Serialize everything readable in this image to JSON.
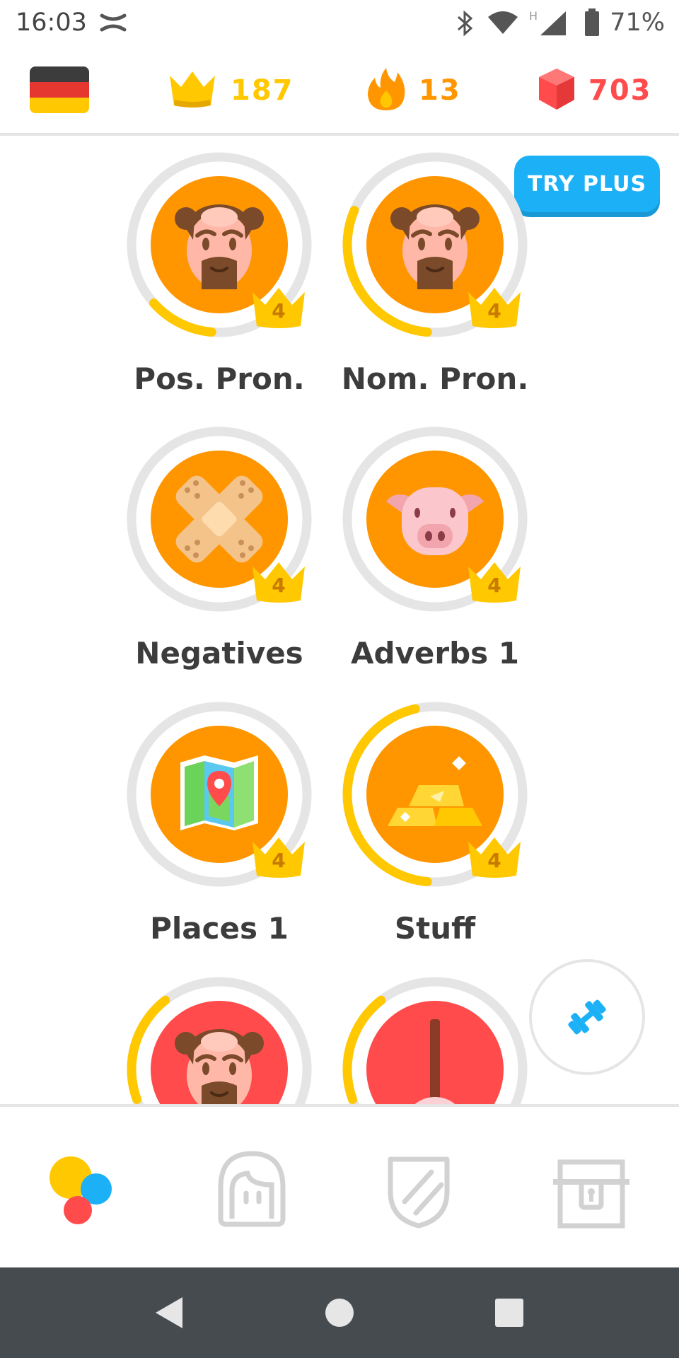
{
  "status_bar": {
    "time": "16:03",
    "battery": "71%",
    "icons": [
      "under-armour-icon",
      "bluetooth-icon",
      "wifi-icon",
      "signal-icon",
      "battery-icon"
    ]
  },
  "top_bar": {
    "flag": "german-flag",
    "crowns": {
      "value": "187",
      "icon": "crown-icon",
      "color": "#ffc800"
    },
    "streak": {
      "value": "13",
      "icon": "flame-icon",
      "color": "#ff9600"
    },
    "gems": {
      "value": "703",
      "icon": "gem-icon",
      "color": "#ff4b4b"
    }
  },
  "try_plus": {
    "label": "TRY PLUS",
    "color": "#1cb0f6"
  },
  "skills": [
    {
      "label": "Pos. Pron.",
      "icon": "man-icon",
      "crown_level": "4",
      "progress": 0.12,
      "color": "#ff9600"
    },
    {
      "label": "Nom. Pron.",
      "icon": "man-icon",
      "crown_level": "4",
      "progress": 0.3,
      "color": "#ff9600"
    },
    {
      "label": "Negatives",
      "icon": "bandage-icon",
      "crown_level": "4",
      "progress": 0,
      "color": "#ff9600"
    },
    {
      "label": "Adverbs 1",
      "icon": "pig-icon",
      "crown_level": "4",
      "progress": 0,
      "color": "#ff9600"
    },
    {
      "label": "Places 1",
      "icon": "map-icon",
      "crown_level": "4",
      "progress": 0,
      "color": "#ff9600"
    },
    {
      "label": "Stuff",
      "icon": "gold-bars-icon",
      "crown_level": "4",
      "progress": 0.45,
      "color": "#ff9600"
    },
    {
      "label": "",
      "icon": "man-icon",
      "progress": 0.2,
      "color": "#ff4b4b"
    },
    {
      "label": "",
      "icon": "plunger-icon",
      "progress": 0.2,
      "color": "#ff4b4b"
    }
  ],
  "practice_button": {
    "icon": "dumbbell-icon"
  },
  "bottom_nav": {
    "items": [
      {
        "name": "learn",
        "icon": "learn-dots-icon",
        "active": true
      },
      {
        "name": "profile",
        "icon": "profile-icon",
        "active": false
      },
      {
        "name": "leagues",
        "icon": "shield-icon",
        "active": false
      },
      {
        "name": "shop",
        "icon": "treasure-chest-icon",
        "active": false
      }
    ]
  },
  "android_nav": {
    "icons": [
      "back-icon",
      "home-icon",
      "recents-icon"
    ]
  }
}
